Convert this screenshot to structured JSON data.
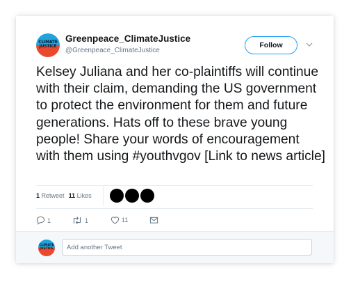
{
  "author": {
    "name": "Greenpeace_ClimateJustice",
    "handle": "@Greenpeace_ClimateJustice",
    "avatar_text": "CLIMATE JUSTICE",
    "avatar_colors": {
      "top": "#21a4d9",
      "bottom": "#e94a2f"
    }
  },
  "follow_button": {
    "label": "Follow",
    "border_color": "#1da1f2"
  },
  "tweet": {
    "text": "Kelsey Juliana and her co-plaintiffs will continue with their claim, demanding the US government to protect the environment for them and future generations. Hats off to these brave young people! Share your words of encouragement with them using #youthvgov [Link to news article]"
  },
  "stats": {
    "retweets_count": "1",
    "retweets_label": "Retweet",
    "likes_count": "11",
    "likes_label": "Likes",
    "liker_avatars": 3
  },
  "actions": {
    "reply_count": "1",
    "retweet_count": "1",
    "like_count": "11"
  },
  "reply": {
    "placeholder": "Add another Tweet"
  },
  "colors": {
    "text": "#14171a",
    "secondary": "#657786",
    "divider": "#e6ecf0",
    "reply_bg": "#f5f8fa"
  }
}
